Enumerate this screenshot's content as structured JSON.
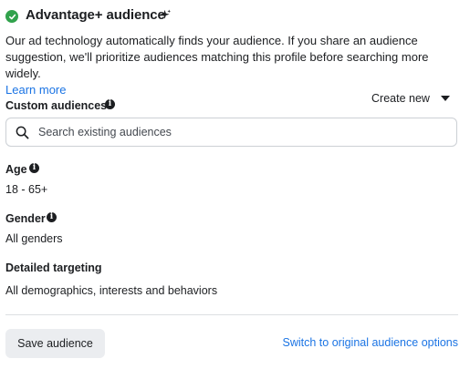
{
  "header": {
    "title": "Advantage+ audience",
    "status_icon": "check-circle-icon",
    "badge_icon": "sparkle-icon",
    "status_color": "#31a24c"
  },
  "description": {
    "text": "Our ad technology automatically finds your audience. If you share an audience suggestion, we'll prioritize audiences matching this profile before searching more widely.",
    "link_label": "Learn more"
  },
  "custom_audiences": {
    "label": "Custom audiences",
    "dropdown_label": "Create new",
    "search_placeholder": "Search existing audiences"
  },
  "age": {
    "label": "Age",
    "value": "18 - 65+"
  },
  "gender": {
    "label": "Gender",
    "value": "All genders"
  },
  "detailed_targeting": {
    "label": "Detailed targeting",
    "value": "All demographics, interests and behaviors"
  },
  "footer": {
    "save_label": "Save audience",
    "switch_label": "Switch to original audience options"
  },
  "colors": {
    "link": "#1b74e4",
    "text": "#1c1e21",
    "button_bg": "#ebedf0"
  }
}
